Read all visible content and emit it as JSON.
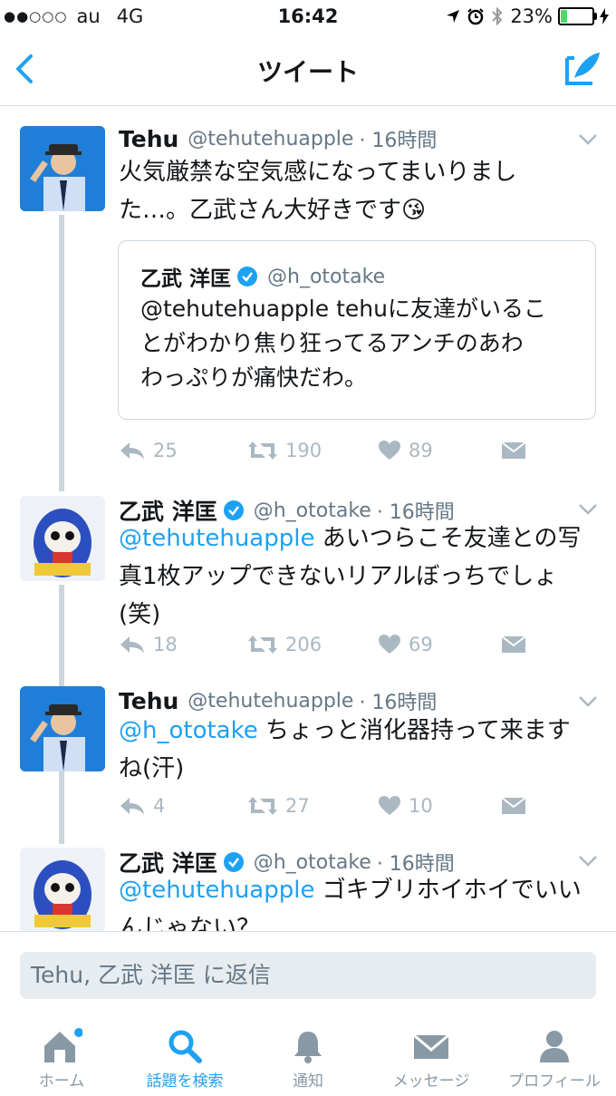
{
  "status_bar": {
    "carrier": "au",
    "network": "4G",
    "time": "16:42",
    "battery": "23%",
    "battery_level": 0.23
  },
  "nav": {
    "title": "ツイート"
  },
  "colors": {
    "accent": "#1da1f2",
    "muted": "#657786",
    "action_gray": "#aab8c2",
    "thread_line": "#ccd6dd"
  },
  "tweets": [
    {
      "name": "Tehu",
      "handle": "@tehutehuapple",
      "time": "· 16時間",
      "verified": false,
      "text_lines": [
        "火気厳禁な空気感になってまいりまし",
        "た…。乙武さん大好きです😘"
      ],
      "quote": {
        "name": "乙武 洋匡",
        "handle": "@h_ototake",
        "verified": true,
        "text_lines": [
          "@tehutehuapple tehuに友達がいるこ",
          "とがわかり焦り狂ってるアンチのあわ",
          "わっぷりが痛快だわ。"
        ]
      },
      "replies": "25",
      "retweets": "190",
      "likes": "89"
    },
    {
      "name": "乙武 洋匡",
      "handle": "@h_ototake",
      "time": "· 16時間",
      "verified": true,
      "mention": "@tehutehuapple",
      "text_lines": [
        "あいつらこそ友達との写",
        "真1枚アップできないリアルぼっちでしょ",
        "(笑)"
      ],
      "replies": "18",
      "retweets": "206",
      "likes": "69"
    },
    {
      "name": "Tehu",
      "handle": "@tehutehuapple",
      "time": "· 16時間",
      "verified": false,
      "mention": "@h_ototake",
      "text_lines": [
        "ちょっと消化器持って来ます",
        "ね(汗)"
      ],
      "replies": "4",
      "retweets": "27",
      "likes": "10"
    },
    {
      "name": "乙武 洋匡",
      "handle": "@h_ototake",
      "time": "· 16時間",
      "verified": true,
      "mention": "@tehutehuapple",
      "text_lines": [
        "ゴキブリホイホイでいい",
        "んじゃない？"
      ]
    }
  ],
  "reply": {
    "placeholder": "Tehu, 乙武 洋匡 に返信"
  },
  "tabs": [
    {
      "label": "ホーム",
      "icon": "home-icon",
      "badge": true
    },
    {
      "label": "話題を検索",
      "icon": "search-icon",
      "active": true
    },
    {
      "label": "通知",
      "icon": "bell-icon"
    },
    {
      "label": "メッセージ",
      "icon": "envelope-icon"
    },
    {
      "label": "プロフィール",
      "icon": "person-icon"
    }
  ]
}
